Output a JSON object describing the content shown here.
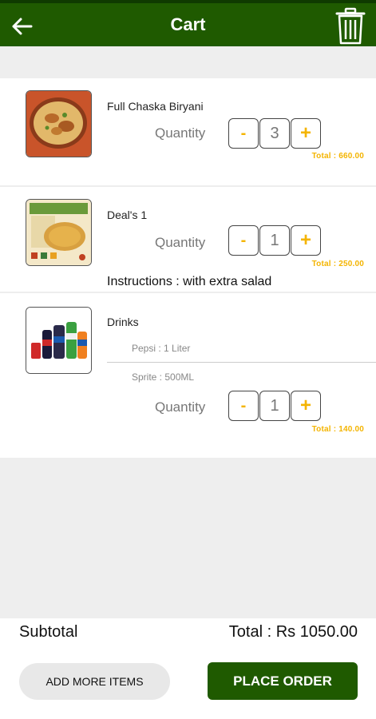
{
  "header": {
    "title": "Cart",
    "back_icon": "arrow-left-icon",
    "delete_icon": "trash-icon",
    "bg_color": "#1f5a00"
  },
  "cart": {
    "quantity_label": "Quantity",
    "minus_label": "-",
    "plus_label": "+",
    "items": [
      {
        "name": "Full Chaska Biryani",
        "quantity": "3",
        "total": "Total : 660.00",
        "image": "biryani-image"
      },
      {
        "name": "Deal's 1",
        "quantity": "1",
        "total": "Total : 250.00",
        "instructions": "Instructions : with extra salad",
        "image": "deal-image"
      },
      {
        "name": "Drinks",
        "quantity": "1",
        "total": "Total : 140.00",
        "image": "drinks-image",
        "options": [
          "Pepsi  :  1 Liter",
          "Sprite  :  500ML"
        ]
      }
    ]
  },
  "footer": {
    "subtotal_label": "Subtotal",
    "total": "Total : Rs 1050.00",
    "add_more_label": "ADD MORE ITEMS",
    "place_order_label": "PLACE ORDER"
  },
  "colors": {
    "primary": "#1f5a00",
    "accent": "#f4b400"
  }
}
